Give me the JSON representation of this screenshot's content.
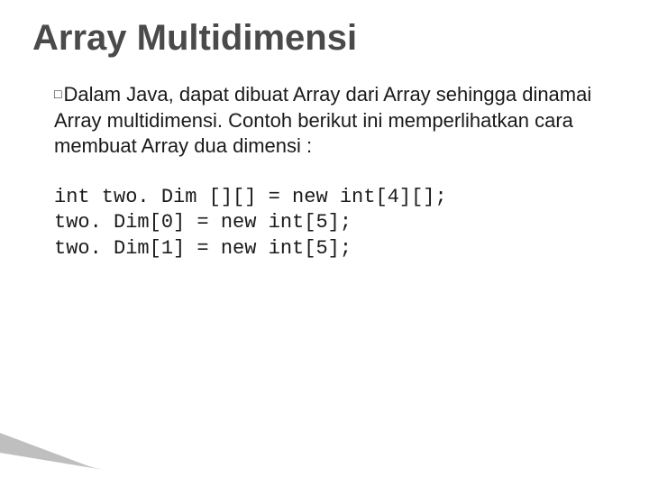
{
  "title": "Array Multidimensi",
  "bullet_glyph": "□",
  "paragraph_lead": "Dalam",
  "paragraph_rest": " Java, dapat dibuat Array dari Array sehingga dinamai Array multidimensi. Contoh berikut ini memperlihatkan cara membuat Array dua dimensi :",
  "code": {
    "line1": "int two. Dim [][] = new int[4][];",
    "line2": "two. Dim[0] = new int[5];",
    "line3": "two. Dim[1] = new int[5];"
  }
}
